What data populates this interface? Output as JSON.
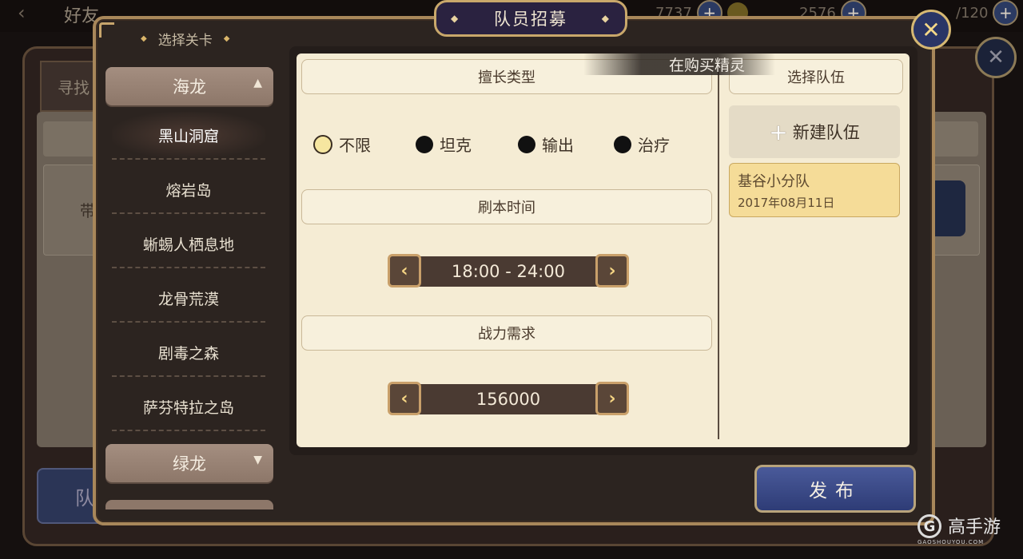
{
  "background": {
    "title": "好友",
    "tab": "寻找",
    "card_text": "带",
    "bottom_button": "队",
    "resources": [
      {
        "value": "7737"
      },
      {
        "value": "2576"
      },
      {
        "value": "/120"
      }
    ]
  },
  "dialog": {
    "title": "队员招募",
    "close_icon": "✕",
    "level_select_title": "选择关卡",
    "groups": [
      {
        "label": "海龙",
        "expanded": true
      },
      {
        "label": "绿龙",
        "expanded": false
      }
    ],
    "levels": [
      {
        "label": "黑山洞窟",
        "selected": true
      },
      {
        "label": "熔岩岛",
        "selected": false
      },
      {
        "label": "蜥蜴人栖息地",
        "selected": false
      },
      {
        "label": "龙骨荒漠",
        "selected": false
      },
      {
        "label": "剧毒之森",
        "selected": false
      },
      {
        "label": "萨芬特拉之岛",
        "selected": false
      }
    ],
    "specialty": {
      "header": "擅长类型",
      "options": [
        {
          "label": "不限",
          "selected": true
        },
        {
          "label": "坦克",
          "selected": false
        },
        {
          "label": "输出",
          "selected": false
        },
        {
          "label": "治疗",
          "selected": false
        }
      ]
    },
    "dungeon_time": {
      "header": "刷本时间",
      "value": "18:00 - 24:00"
    },
    "power": {
      "header": "战力需求",
      "value": "156000"
    },
    "team": {
      "header": "选择队伍",
      "new_team_label": "新建队伍",
      "teams": [
        {
          "name": "基谷小分队",
          "date": "2017年08月11日"
        }
      ]
    },
    "publish_label": "发布",
    "toast": "在购买精灵"
  },
  "watermark": {
    "text": "高手游",
    "sub": "GAOSHOUYOU.COM"
  },
  "colors": {
    "accent_gold": "#c9a86b",
    "panel_bg": "#f5ecd4",
    "button_blue": "#2e3c76",
    "selected_team": "#f5dc98"
  }
}
